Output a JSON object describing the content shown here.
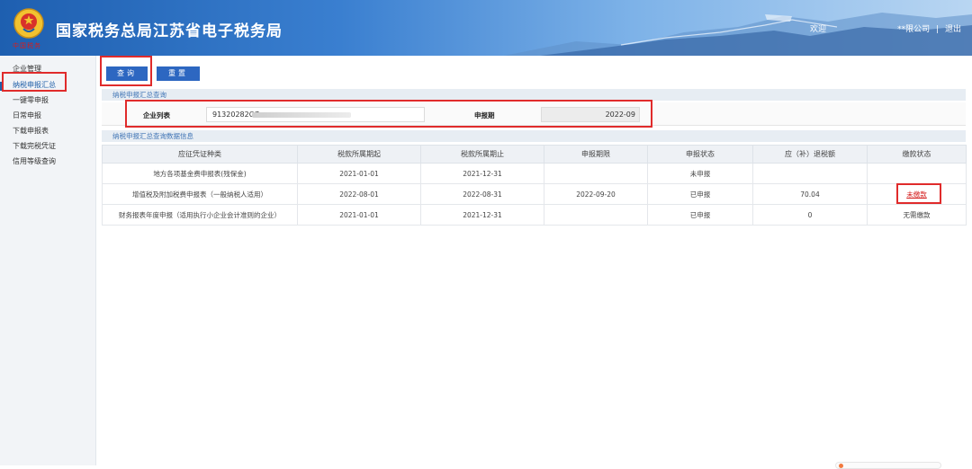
{
  "header": {
    "title": "国家税务总局江苏省电子税务局",
    "slogan": "中国税务",
    "welcome": "欢迎",
    "company": "**限公司",
    "separator": "|",
    "logout": "退出"
  },
  "sidebar": {
    "items": [
      {
        "label": "企业管理"
      },
      {
        "label": "纳税申报汇总"
      },
      {
        "label": "一键零申报"
      },
      {
        "label": "日常申报"
      },
      {
        "label": "下载申报表"
      },
      {
        "label": "下载完税凭证"
      },
      {
        "label": "信用等级查询"
      }
    ]
  },
  "toolbar": {
    "query_label": "查询",
    "reset_label": "重置"
  },
  "query_section": {
    "title": "纳税申报汇总查询",
    "company_label": "企业列表",
    "company_value": "91320282O7",
    "period_label": "申报期",
    "period_value": "2022-09"
  },
  "results_section": {
    "title": "纳税申报汇总查询数据信息",
    "columns": [
      "应征凭证种类",
      "税款所属期起",
      "税款所属期止",
      "申报期限",
      "申报状态",
      "应（补）退税额",
      "缴款状态"
    ],
    "rows": [
      {
        "type": "地方各项基金费申报表(残保金)",
        "start": "2021-01-01",
        "end": "2021-12-31",
        "deadline": "",
        "status": "未申报",
        "amount": "",
        "pay": ""
      },
      {
        "type": "增值税及附加税费申报表（一般纳税人适用）",
        "start": "2022-08-01",
        "end": "2022-08-31",
        "deadline": "2022-09-20",
        "status": "已申报",
        "amount": "70.04",
        "pay": "未缴款"
      },
      {
        "type": "财务报表年度申报（适用执行小企业会计准则的企业）",
        "start": "2021-01-01",
        "end": "2021-12-31",
        "deadline": "",
        "status": "已申报",
        "amount": "0",
        "pay": "无需缴款"
      }
    ]
  },
  "colors": {
    "header_blue": "#1e5fb0",
    "button_blue": "#2d67c1",
    "highlight_red": "#e02b2b",
    "status_declared": "#2b8a2b",
    "status_undeclared": "#3970c4",
    "unpaid_red": "#d41c1c"
  },
  "icons": {
    "logo": "tax-emblem-icon"
  }
}
